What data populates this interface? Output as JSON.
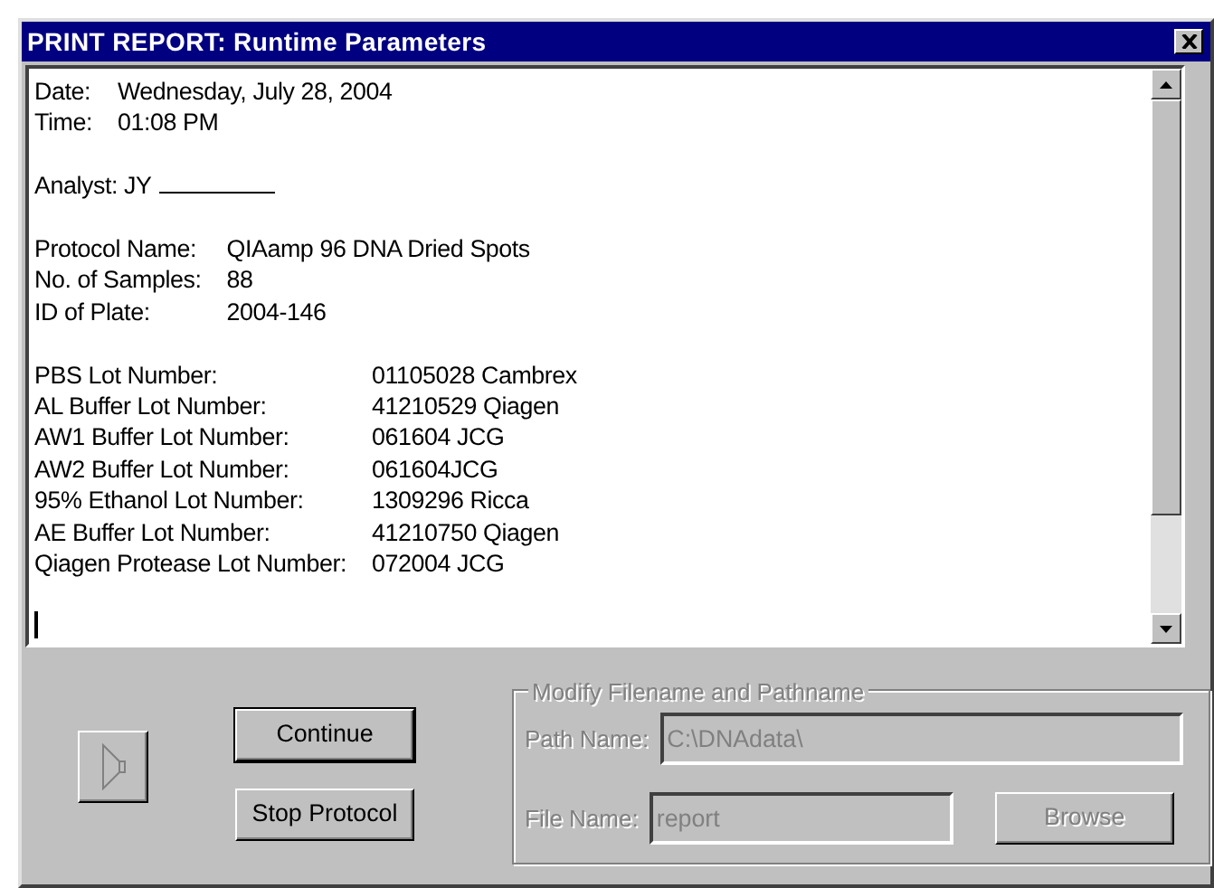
{
  "window": {
    "title": "PRINT REPORT: Runtime Parameters"
  },
  "report": {
    "groups": [
      {
        "lines": [
          {
            "kind": "pair",
            "label": "Date:",
            "value": "Wednesday, July 28, 2004"
          },
          {
            "kind": "pair",
            "label": "Time:",
            "value": "01:08 PM"
          }
        ]
      },
      {
        "lines": [
          {
            "kind": "signature",
            "label": "Analyst: JY"
          }
        ]
      },
      {
        "lines": [
          {
            "kind": "pair",
            "label": "Protocol Name:",
            "value": "QIAamp 96 DNA Dried Spots"
          },
          {
            "kind": "pair",
            "label": "No. of Samples:",
            "value": "88"
          },
          {
            "kind": "pair",
            "label": "ID of Plate:",
            "value": "2004-146"
          }
        ]
      },
      {
        "lines": [
          {
            "kind": "pair",
            "label": "PBS Lot Number:",
            "value": "01105028 Cambrex"
          },
          {
            "kind": "pair",
            "label": "AL Buffer Lot Number:",
            "value": "41210529 Qiagen"
          },
          {
            "kind": "pair",
            "label": "AW1 Buffer Lot Number:",
            "value": "061604 JCG"
          },
          {
            "kind": "pair",
            "label": "AW2 Buffer Lot Number:",
            "value": "061604JCG"
          },
          {
            "kind": "pair",
            "label": "95% Ethanol Lot Number:",
            "value": "1309296 Ricca"
          },
          {
            "kind": "pair",
            "label": "AE Buffer Lot Number:",
            "value": "41210750 Qiagen"
          },
          {
            "kind": "pair",
            "label": "Qiagen Protease Lot Number:",
            "value": "072004 JCG"
          }
        ]
      }
    ]
  },
  "buttons": [
    {
      "label": "Continue",
      "default": true
    },
    {
      "label": "Stop Protocol",
      "default": false
    }
  ],
  "file_group": {
    "legend": "Modify Filename and Pathname",
    "disabled": true,
    "path": {
      "label": "Path Name:",
      "value": "C:\\DNAdata\\"
    },
    "file": {
      "label": "File Name:",
      "value": "report"
    },
    "browse": {
      "label": "Browse"
    }
  }
}
